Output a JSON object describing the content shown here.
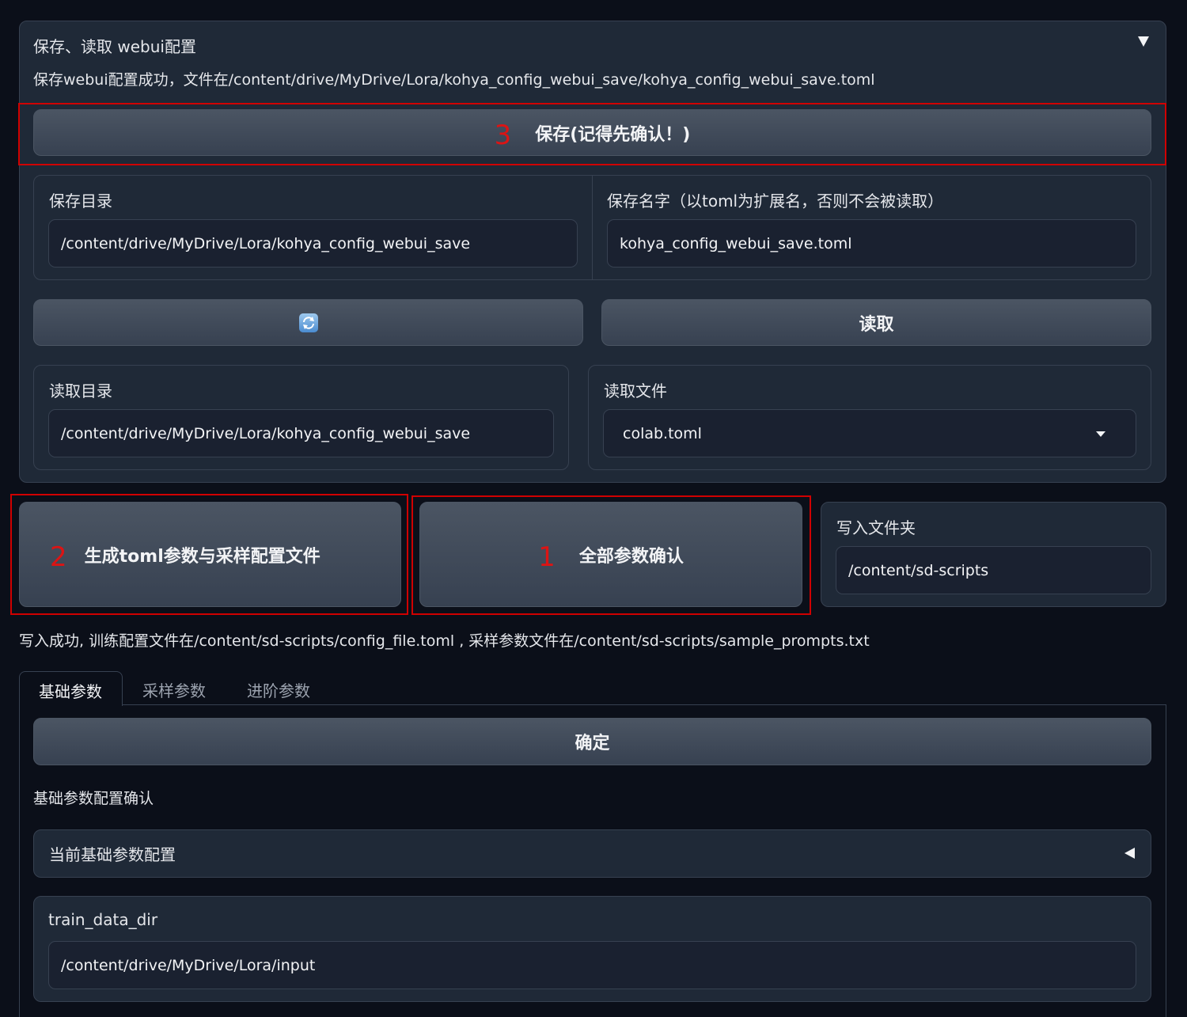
{
  "save_panel": {
    "title": "保存、读取 webui配置",
    "collapse_icon": "triangle-down-icon",
    "status": "保存webui配置成功，文件在/content/drive/MyDrive/Lora/kohya_config_webui_save/kohya_config_webui_save.toml",
    "save_button": {
      "num": "3",
      "label": "保存(记得先确认！)"
    },
    "save_dir": {
      "label": "保存目录",
      "value": "/content/drive/MyDrive/Lora/kohya_config_webui_save"
    },
    "save_name": {
      "label": "保存名字（以toml为扩展名，否则不会被读取）",
      "value": "kohya_config_webui_save.toml"
    },
    "refresh_icon": "refresh-icon",
    "load_button": "读取",
    "load_dir": {
      "label": "读取目录",
      "value": "/content/drive/MyDrive/Lora/kohya_config_webui_save"
    },
    "load_file": {
      "label": "读取文件",
      "value": "colab.toml"
    }
  },
  "actions": {
    "generate": {
      "num": "2",
      "label": "生成toml参数与采样配置文件"
    },
    "confirm_all": {
      "num": "1",
      "label": "全部参数确认"
    },
    "write_folder": {
      "label": "写入文件夹",
      "value": "/content/sd-scripts"
    }
  },
  "write_status": "写入成功, 训练配置文件在/content/sd-scripts/config_file.toml , 采样参数文件在/content/sd-scripts/sample_prompts.txt",
  "tabs": [
    "基础参数",
    "采样参数",
    "进阶参数"
  ],
  "active_tab": 0,
  "confirm_button": "确定",
  "confirm_text": "基础参数配置确认",
  "accordion": {
    "title": "当前基础参数配置",
    "icon": "triangle-left-icon"
  },
  "train_data_dir": {
    "label": "train_data_dir",
    "value": "/content/drive/MyDrive/Lora/input"
  }
}
